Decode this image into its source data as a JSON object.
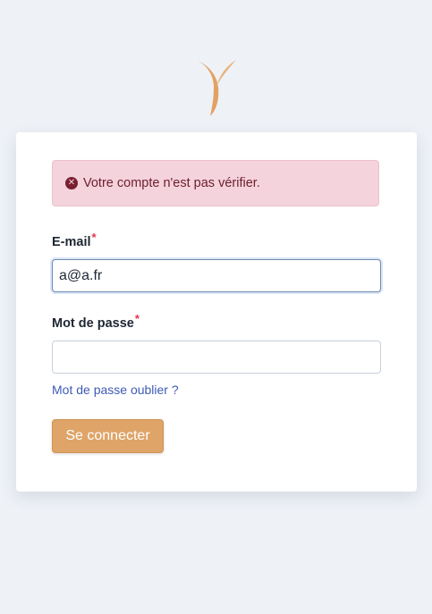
{
  "brand": {
    "logo_icon": "brand-y-logo-icon",
    "accent_color": "#e3a163"
  },
  "alert": {
    "icon": "error-circle-icon",
    "message": "Votre compte n'est pas vérifier.",
    "background": "#f4d3dc",
    "text_color": "#6e1d2d"
  },
  "form": {
    "email": {
      "label": "E-mail",
      "required_mark": "*",
      "value": "a@a.fr",
      "placeholder": ""
    },
    "password": {
      "label": "Mot de passe",
      "required_mark": "*",
      "value": "",
      "placeholder": ""
    },
    "forgot_link": "Mot de passe oublier ?",
    "submit_label": "Se connecter"
  }
}
